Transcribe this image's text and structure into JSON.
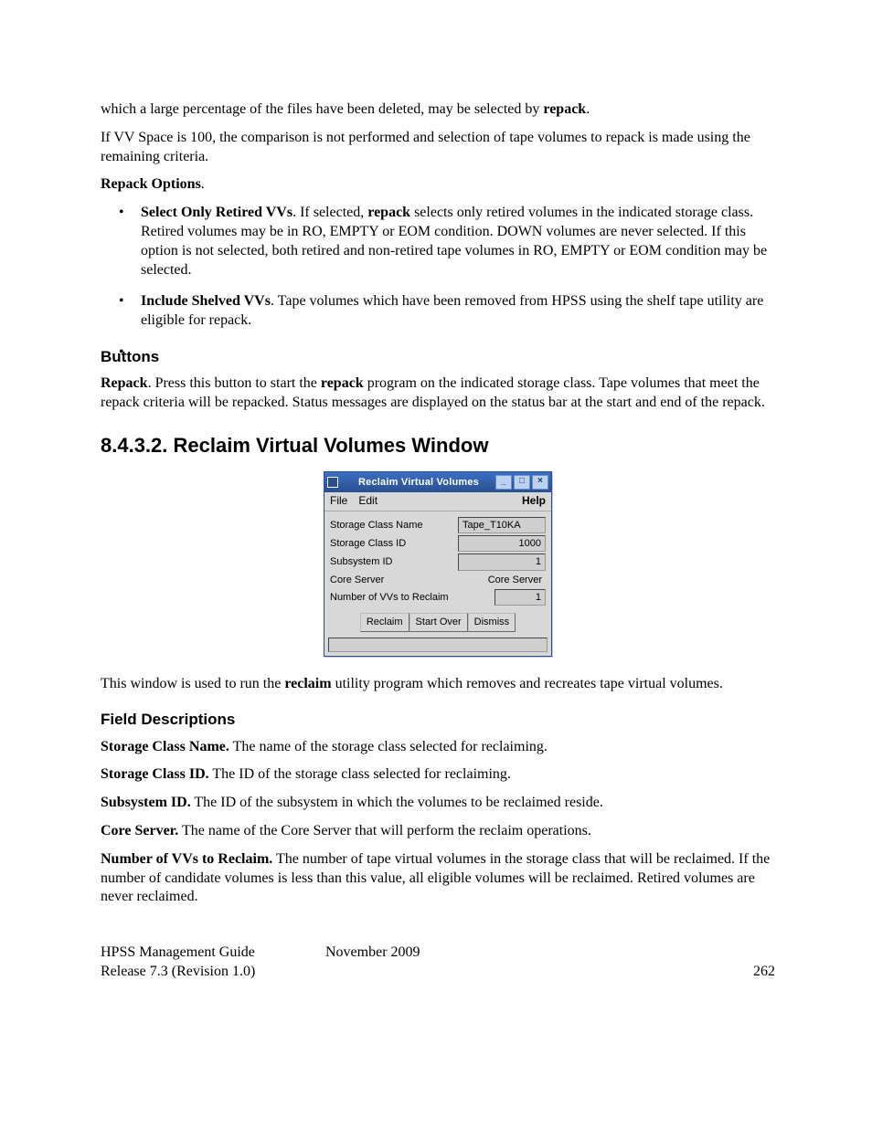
{
  "intro": {
    "p1_a": "which a large percentage of the files have been deleted, may be selected by ",
    "p1_b": "repack",
    "p1_c": ".",
    "p2": "If VV Space is 100, the comparison is not performed and selection of tape volumes to repack is made using the remaining criteria.",
    "repack_options_label": "Repack Options",
    "repack_options_dot": "."
  },
  "bullets": {
    "b1_strong": "Select Only Retired VVs",
    "b1_mid_a": ". If selected, ",
    "b1_rep": "repack",
    "b1_rest": " selects only retired volumes in the indicated storage class. Retired volumes may be in RO, EMPTY or EOM condition. DOWN volumes are never selected. If this option is not selected, both retired and non-retired tape volumes in RO, EMPTY or EOM condition may be selected.",
    "b2_strong": "Include Shelved VVs",
    "b2_rest": ". Tape volumes which have been removed from HPSS using the shelf tape utility are eligible for repack."
  },
  "buttons_section": {
    "heading": "Buttons",
    "p_a": "Repack",
    "p_b": ". Press this button to start the ",
    "p_c": "repack",
    "p_d": " program on the indicated storage class. Tape volumes that meet the repack criteria will be repacked. Status messages are displayed on the status bar at the start and end of the repack."
  },
  "reclaim_section": {
    "heading": "8.4.3.2.   Reclaim Virtual Volumes Window",
    "after_a": "This window is used to run the ",
    "after_b": "reclaim",
    "after_c": " utility program which removes and recreates tape virtual volumes."
  },
  "dialog": {
    "title": "Reclaim Virtual Volumes",
    "menu": {
      "file": "File",
      "edit": "Edit",
      "help": "Help"
    },
    "fields": {
      "scn_label": "Storage Class Name",
      "scn_value": "Tape_T10KA",
      "sci_label": "Storage Class ID",
      "sci_value": "1000",
      "sub_label": "Subsystem ID",
      "sub_value": "1",
      "cs_label": "Core Server",
      "cs_value": "Core Server",
      "nvv_label": "Number of VVs to Reclaim",
      "nvv_value": "1"
    },
    "buttons": {
      "reclaim": "Reclaim",
      "start_over": "Start Over",
      "dismiss": "Dismiss"
    }
  },
  "field_desc": {
    "heading": "Field Descriptions",
    "scn_b": "Storage Class Name.",
    "scn_t": " The name of the storage class selected for reclaiming.",
    "sci_b": "Storage Class ID.",
    "sci_t": " The ID of the storage class selected for reclaiming.",
    "sub_b": "Subsystem ID.",
    "sub_t": " The ID of the subsystem in which the volumes to be reclaimed reside.",
    "cs_b": "Core Server.",
    "cs_t": " The name of the Core Server that will perform the reclaim operations.",
    "nvv_b": "Number of VVs to Reclaim.",
    "nvv_t": " The number of tape virtual volumes in the storage class that will be reclaimed. If the number of candidate volumes is less than this value, all eligible volumes will be reclaimed. Retired volumes are never reclaimed."
  },
  "footer": {
    "guide": "HPSS Management Guide",
    "release": "Release 7.3 (Revision 1.0)",
    "date": "November 2009",
    "page": "262"
  }
}
